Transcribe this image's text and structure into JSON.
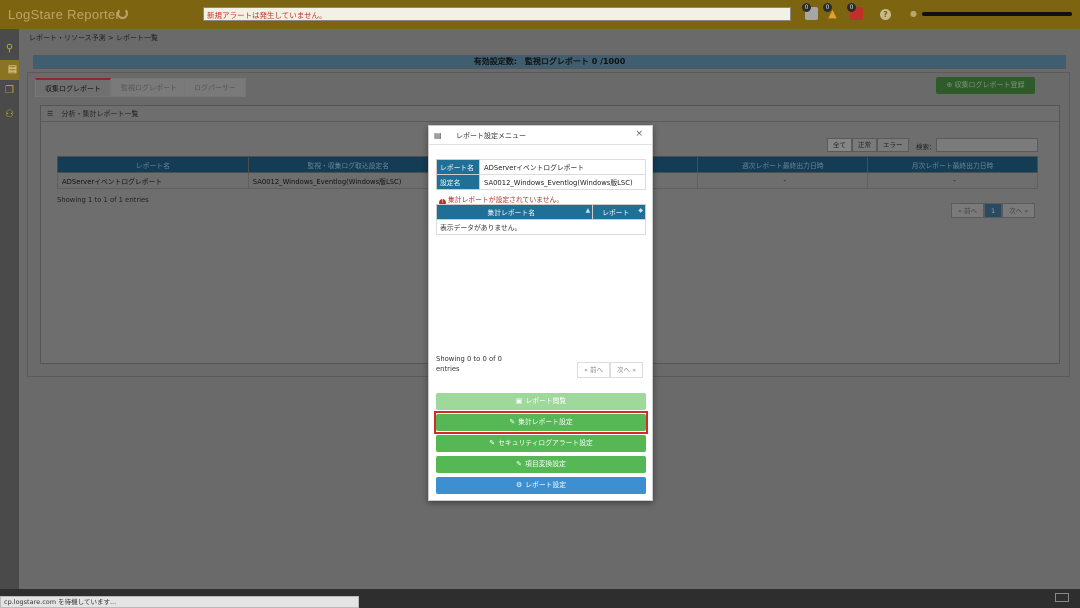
{
  "app": {
    "title": "LogStare Reporter",
    "alert_message": "新規アラートは発生していません。",
    "badges": [
      "0",
      "0",
      "0"
    ],
    "status_url": "cp.logstare.com を待機しています..."
  },
  "icons": {
    "refresh": "refresh-icon",
    "search": "search-icon",
    "report": "chart-icon",
    "copy": "copy-icon",
    "users": "users-icon",
    "help": "question-icon",
    "user": "user-icon"
  },
  "breadcrumb": "レポート・リソース予測 > レポート一覧",
  "summary": "有効設定数:　監視ログレポート  0 /1000",
  "tabs": [
    {
      "label": "収集ログレポート"
    },
    {
      "label": "監視ログレポート"
    },
    {
      "label": "ログパーサー"
    }
  ],
  "register_button": "⊕ 収集ログレポート登録",
  "panel_title": "分析・集計レポート一覧",
  "filters": [
    "全て",
    "正常",
    "エラー"
  ],
  "search_label": "検索：",
  "main_table": {
    "headers": [
      "レポート名",
      "監視・収集ログ取込設定名",
      "",
      "週次レポート最終出力日時",
      "月次レポート最終出力日時"
    ],
    "rows": [
      [
        "ADServerイベントログレポート",
        "SA0012_Windows_Eventlog(Windows版LSC)",
        "",
        "-",
        "-"
      ]
    ]
  },
  "main_showing": "Showing 1 to 1 of 1 entries",
  "main_pager": {
    "prev": "« 前へ",
    "current": "1",
    "next": "次へ »"
  },
  "modal": {
    "title": "レポート設定メニュー",
    "close": "×",
    "report_name_label": "レポート名",
    "report_name_value": "ADServerイベントログレポート",
    "setting_name_label": "設定名",
    "setting_name_value": "SA0012_Windows_Eventlog(Windows版LSC)",
    "warning": "集計レポートが設定されていません。",
    "agg_headers": [
      "集計レポート名",
      "レポート"
    ],
    "empty_message": "表示データがありません。",
    "showing": "Showing 0 to 0 of 0 entries",
    "pager_prev": "« 前へ",
    "pager_next": "次へ »",
    "buttons": [
      {
        "label": "レポート閲覧",
        "icon": "image-icon"
      },
      {
        "label": "集計レポート設定",
        "icon": "edit-icon"
      },
      {
        "label": "セキュリティログアラート設定",
        "icon": "edit-icon"
      },
      {
        "label": "項目変換設定",
        "icon": "edit-icon"
      },
      {
        "label": "レポート設定",
        "icon": "gear-icon"
      }
    ]
  },
  "colors": {
    "topbar": "#7d6410",
    "table_header": "#1f6f96",
    "green_button": "#56b755",
    "blue_button": "#3d8fd0",
    "highlight": "#d42a2a"
  }
}
